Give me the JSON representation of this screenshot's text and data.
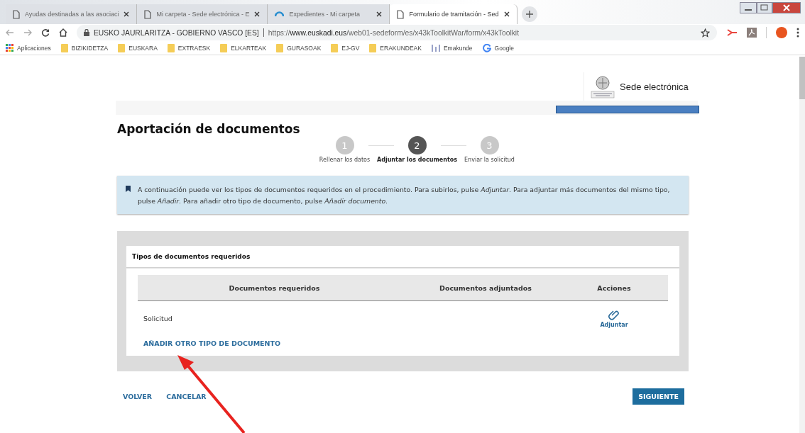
{
  "browser": {
    "tabs": [
      {
        "title": "Ayudas destinadas a las asociaci",
        "kind": "page",
        "selected": false
      },
      {
        "title": "Mi carpeta - Sede electrónica - E",
        "kind": "page",
        "selected": false
      },
      {
        "title": "Expedientes - Mi carpeta",
        "kind": "app",
        "selected": false
      },
      {
        "title": "Formulario de tramitación - Sed",
        "kind": "page",
        "selected": true
      }
    ],
    "site_info": "EUSKO JAURLARITZA - GOBIERNO VASCO [ES]",
    "url": "https://**www.euskadi.eus**/web01-sedeform/es/x43kToolkitWar/form/x43kToolkit",
    "bookmarks": [
      {
        "label": "Aplicaciones",
        "kind": "apps"
      },
      {
        "label": "BIZIKIDETZA",
        "kind": "folder"
      },
      {
        "label": "EUSKARA",
        "kind": "folder"
      },
      {
        "label": "EXTRAESK",
        "kind": "folder"
      },
      {
        "label": "ELKARTEAK",
        "kind": "folder"
      },
      {
        "label": "GURASOAK",
        "kind": "folder"
      },
      {
        "label": "EJ-GV",
        "kind": "folder"
      },
      {
        "label": "ERAKUNDEAK",
        "kind": "folder"
      },
      {
        "label": "Emakunde",
        "kind": "site"
      },
      {
        "label": "Google",
        "kind": "google"
      }
    ]
  },
  "header": {
    "brand": "Sede electrónica"
  },
  "page_title": "Aportación de documentos",
  "steps": [
    {
      "number": "1",
      "label": "Rellenar los datos",
      "selected": false
    },
    {
      "number": "2",
      "label": "Adjuntar los documentos",
      "selected": true
    },
    {
      "number": "3",
      "label": "Enviar la solicitud",
      "selected": false
    }
  ],
  "info": "A continuación puede ver los tipos de documentos requeridos en el procedimiento. Para subirlos, pulse *Adjuntar*. Para adjuntar más documentos del mismo tipo, pulse *Añadir*. Para añadir otro tipo de documento, pulse *Añadir documento*.",
  "documents": {
    "title": "Tipos de documentos requeridos",
    "columns": [
      "Documentos requeridos",
      "Documentos adjuntados",
      "Acciones"
    ],
    "rows": [
      {
        "name": "Solicitud",
        "action": "Adjuntar"
      }
    ],
    "add_link": "AÑADIR OTRO TIPO DE DOCUMENTO"
  },
  "footer": {
    "back": "VOLVER",
    "cancel": "CANCELAR",
    "next": "SIGUIENTE"
  }
}
